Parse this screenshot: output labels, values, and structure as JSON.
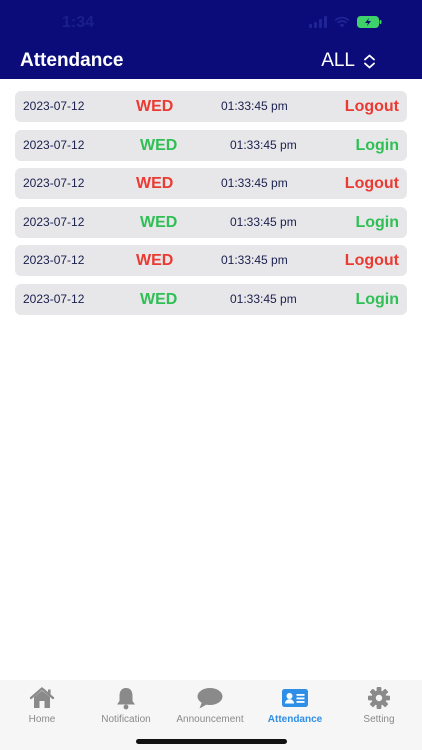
{
  "status_bar": {
    "time": "1:34"
  },
  "header": {
    "title": "Attendance",
    "filter_label": "ALL"
  },
  "records": [
    {
      "date": "2023-07-12",
      "day": "WED",
      "time": "01:33:45 pm",
      "action": "Logout",
      "type": "logout"
    },
    {
      "date": "2023-07-12",
      "day": "WED",
      "time": "01:33:45 pm",
      "action": "Login",
      "type": "login"
    },
    {
      "date": "2023-07-12",
      "day": "WED",
      "time": "01:33:45 pm",
      "action": "Logout",
      "type": "logout"
    },
    {
      "date": "2023-07-12",
      "day": "WED",
      "time": "01:33:45 pm",
      "action": "Login",
      "type": "login"
    },
    {
      "date": "2023-07-12",
      "day": "WED",
      "time": "01:33:45 pm",
      "action": "Logout",
      "type": "logout"
    },
    {
      "date": "2023-07-12",
      "day": "WED",
      "time": "01:33:45 pm",
      "action": "Login",
      "type": "login"
    }
  ],
  "colors": {
    "header": "#0b0c7a",
    "logout": "#ea3a32",
    "login": "#2fbf55",
    "tab_active": "#2f8fe6",
    "tab_inactive": "#8a8a8a"
  },
  "tabs": [
    {
      "label": "Home",
      "icon": "house-icon"
    },
    {
      "label": "Notification",
      "icon": "bell-icon"
    },
    {
      "label": "Announcement",
      "icon": "speech-bubble-icon"
    },
    {
      "label": "Attendance",
      "icon": "id-card-icon",
      "active": true
    },
    {
      "label": "Setting",
      "icon": "gear-icon"
    }
  ]
}
